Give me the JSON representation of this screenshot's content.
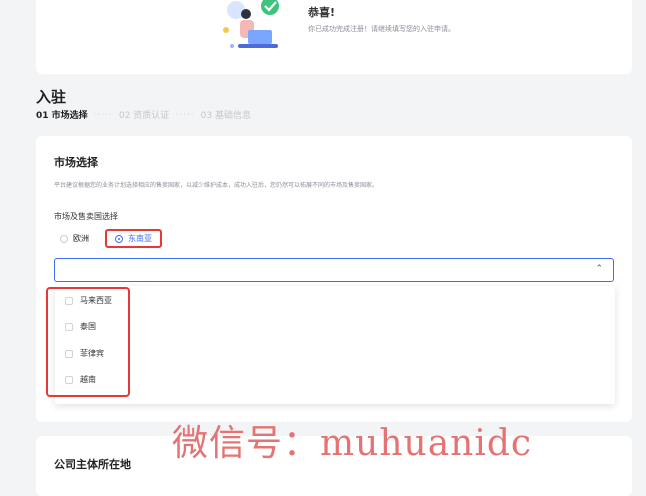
{
  "congrats": {
    "title": "恭喜!",
    "message": "你已成功完成注册！请继续填写您的入驻申请。"
  },
  "page": {
    "section_title": "入驻",
    "steps": [
      {
        "label": "01 市场选择"
      },
      {
        "label": "02 资质认证"
      },
      {
        "label": "03 基础信息"
      }
    ],
    "step_separator": "·····"
  },
  "market": {
    "title": "市场选择",
    "description": "平台建议根据您的业务计划选择相应的售卖国家，以减少维护成本，成功入驻后，您仍然可以拓展不同的市场及售卖国家。",
    "field_label": "市场及售卖国选择",
    "radios": [
      {
        "label": "欧洲",
        "checked": false
      },
      {
        "label": "东南亚",
        "checked": true
      }
    ],
    "select_value": "",
    "chevron": "chevron-up-icon",
    "options": [
      {
        "label": "马来西亚"
      },
      {
        "label": "泰国"
      },
      {
        "label": "菲律宾"
      },
      {
        "label": "越南"
      }
    ]
  },
  "company": {
    "title": "公司主体所在地"
  },
  "watermark": "微信号：muhuanidc",
  "colors": {
    "accent": "#3b6ef5",
    "highlight": "#e53935",
    "watermark": "#e57373"
  }
}
